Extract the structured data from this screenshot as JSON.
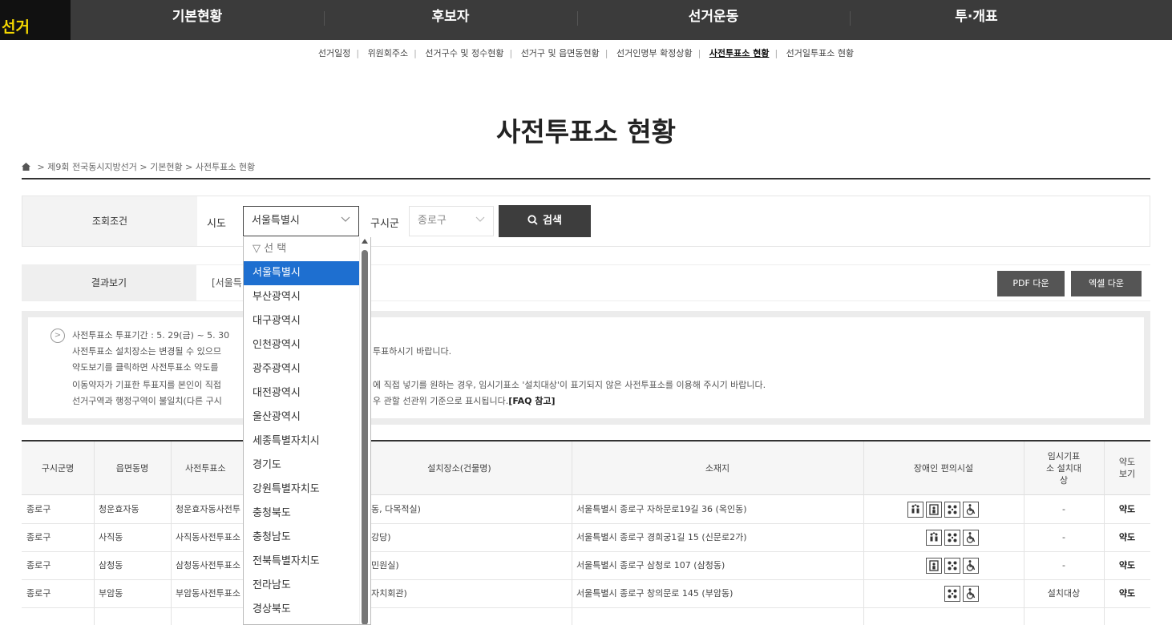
{
  "topnav": {
    "brand": "선거",
    "menu": [
      "기본현황",
      "후보자",
      "선거운동",
      "투·개표"
    ]
  },
  "subnav": {
    "items": [
      "선거일정",
      "위원회주소",
      "선거구수 및 정수현황",
      "선거구 및 읍면동현황",
      "선거인명부 확정상황",
      "사전투표소 현황",
      "선거일투표소 현황"
    ],
    "active": "사전투표소 현황"
  },
  "page_title": "사전투표소 현황",
  "breadcrumb": [
    "제9회 전국동시지방선거",
    "기본현황",
    "사전투표소 현황"
  ],
  "search": {
    "label": "조회조건",
    "sido_label": "시도",
    "sido_value": "서울특별시",
    "gu_label": "구시군",
    "gu_value": "종로구",
    "button": "검색"
  },
  "result": {
    "label": "결과보기",
    "text": "[서울특",
    "pdf_button": "PDF 다운",
    "excel_button": "엑셀 다운"
  },
  "notice": {
    "left": [
      "사전투표소 투표기간 : 5. 29(금) ~ 5. 30",
      "사전투표소 설치장소는 변경될 수 있으므",
      "약도보기를 클릭하면 사전투표소 약도를",
      "이동약자가 기표한 투표지를 본인이 직접",
      "선거구역과 행정구역이 불일치(다른 구시"
    ],
    "right": [
      "",
      "투표하시기 바랍니다.",
      "",
      "에 직접 넣기를 원하는 경우, 임시기표소 '설치대상'이 표기되지 않은 사전투표소를 이용해 주시기 바랍니다.",
      "우 관할 선관위 기준으로 표시됩니다."
    ],
    "faq": "[FAQ 참고]"
  },
  "table": {
    "headers": [
      "구시군명",
      "읍면동명",
      "사전투표소",
      "설치장소(건물명)",
      "소재지",
      "장애인 편의시설",
      "임시기표소 설치대상",
      "약도 보기"
    ],
    "rows": [
      {
        "gu": "종로구",
        "dong": "청운효자동",
        "station": "청운효자동사전투",
        "place": "동, 다목적실)",
        "address": "서울특별시 종로구 자하문로19길 36 (옥인동)",
        "icons": [
          "elevator-icon",
          "lift-icon",
          "braille-icon",
          "wheelchair-icon"
        ],
        "booth": "-",
        "map": "약도"
      },
      {
        "gu": "종로구",
        "dong": "사직동",
        "station": "사직동사전투표소",
        "place": "강당)",
        "address": "서울특별시 종로구 경희궁1길 15 (신문로2가)",
        "icons": [
          "elevator-icon",
          "braille-icon",
          "wheelchair-icon"
        ],
        "booth": "-",
        "map": "약도"
      },
      {
        "gu": "종로구",
        "dong": "삼청동",
        "station": "삼청동사전투표소",
        "place": "민원실)",
        "address": "서울특별시 종로구 삼청로 107 (삼청동)",
        "icons": [
          "lift-icon",
          "braille-icon",
          "wheelchair-icon"
        ],
        "booth": "-",
        "map": "약도"
      },
      {
        "gu": "종로구",
        "dong": "부암동",
        "station": "부암동사전투표소",
        "place": "자치회관)",
        "address": "서울특별시 종로구 창의문로 145 (부암동)",
        "icons": [
          "braille-icon",
          "wheelchair-icon"
        ],
        "booth": "설치대상",
        "map": "약도"
      }
    ]
  },
  "dropdown": {
    "options": [
      "▽ 선 택",
      "서울특별시",
      "부산광역시",
      "대구광역시",
      "인천광역시",
      "광주광역시",
      "대전광역시",
      "울산광역시",
      "세종특별자치시",
      "경기도",
      "강원특별자치도",
      "충청북도",
      "충청남도",
      "전북특별자치도",
      "전라남도",
      "경상북도"
    ],
    "selected": "서울특별시"
  },
  "colors": {
    "nav_bg": "#3b3b3b",
    "brand_fg": "#f5d800",
    "selected_option": "#1e6fd0"
  }
}
